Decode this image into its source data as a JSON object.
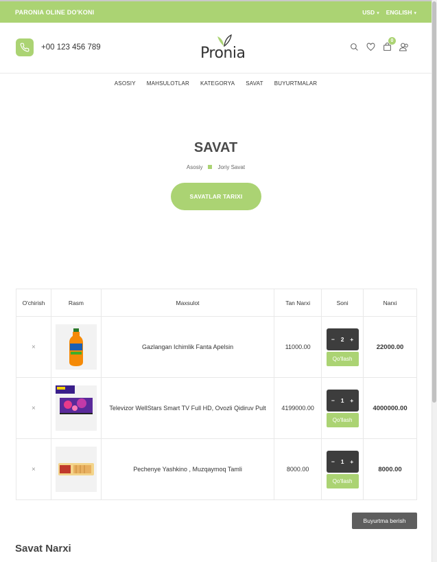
{
  "topbar": {
    "shop_name": "PARONIA OLINE DO'KONI",
    "currency": "USD",
    "language": "ENGLISH"
  },
  "header": {
    "phone": "+00 123 456 789",
    "logo": "Pronia",
    "cart_count": "0"
  },
  "nav": [
    "ASOSIY",
    "MAHSULOTLAR",
    "KATEGORYA",
    "SAVAT",
    "BUYURTMALAR"
  ],
  "page": {
    "title": "SAVAT",
    "breadcrumb_home": "Asosiy",
    "breadcrumb_current": "Joriy Savat",
    "history_button": "SAVATLAR TARIXI"
  },
  "table": {
    "headers": [
      "O'chirish",
      "Rasm",
      "Maxsulot",
      "Tan Narxi",
      "Soni",
      "Narxi"
    ],
    "rows": [
      {
        "remove": "×",
        "name": "Gazlangan Ichimlik Fanta Apelsin",
        "unit_price": "11000.00",
        "qty": "2",
        "apply": "Qo'llash",
        "total": "22000.00"
      },
      {
        "remove": "×",
        "name": "Televizor WellStars Smart TV Full HD, Ovozli Qidiruv Pult",
        "unit_price": "4199000.00",
        "qty": "1",
        "apply": "Qo'llash",
        "total": "4000000.00"
      },
      {
        "remove": "×",
        "name": "Pechenye Yashkino , Muzqaymoq Tamli",
        "unit_price": "8000.00",
        "qty": "1",
        "apply": "Qo'llash",
        "total": "8000.00"
      }
    ],
    "qty_minus": "−",
    "qty_plus": "+"
  },
  "order_button": "Buyurtma berish",
  "cart_total_title": "Savat Narxi",
  "colors": {
    "accent": "#abd373",
    "dark": "#3d3d3d",
    "order_btn": "#5e5e5e"
  }
}
